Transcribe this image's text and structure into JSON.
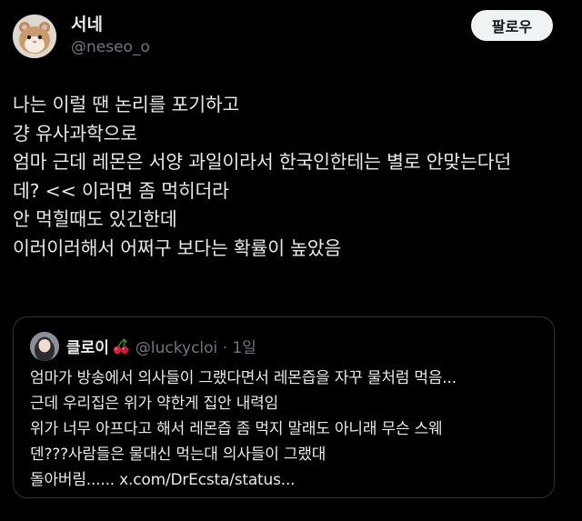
{
  "author": {
    "display_name": "서네",
    "handle": "@neseo_o",
    "avatar_icon": "hamster-avatar"
  },
  "follow_button": {
    "label": "팔로우"
  },
  "tweet": {
    "lines": [
      "나는 이럴 땐 논리를 포기하고",
      "걍 유사과학으로",
      "엄마 근데 레몬은 서양 과일이라서 한국인한테는 별로 안맞는다던",
      "데? << 이러면 좀 먹히더라",
      "안 먹힐때도 있긴한데",
      "이러이러해서 어쩌구 보다는 확률이 높았음"
    ]
  },
  "quote": {
    "display_name": "클로이",
    "emoji_icon": "cherries-icon",
    "handle": "@luckycloi",
    "separator": "·",
    "time": "1일",
    "lines": [
      "엄마가 방송에서 의사들이 그랬다면서 레몬즙을 자꾸 물처럼 먹음...",
      "근데 우리집은 위가 약한게 집안 내력임",
      "위가 너무 아프다고 해서 레몬즙 좀 먹지 말래도 아니래 무슨 스웨",
      "덴???사람들은 물대신 먹는대 의사들이 그랬대",
      "돌아버림...... x.com/DrEcsta/status..."
    ]
  },
  "colors": {
    "background": "#000000",
    "text_primary": "#e7e9ea",
    "text_secondary": "#71767b",
    "border": "#2f3336",
    "button_bg": "#eff3f4"
  }
}
